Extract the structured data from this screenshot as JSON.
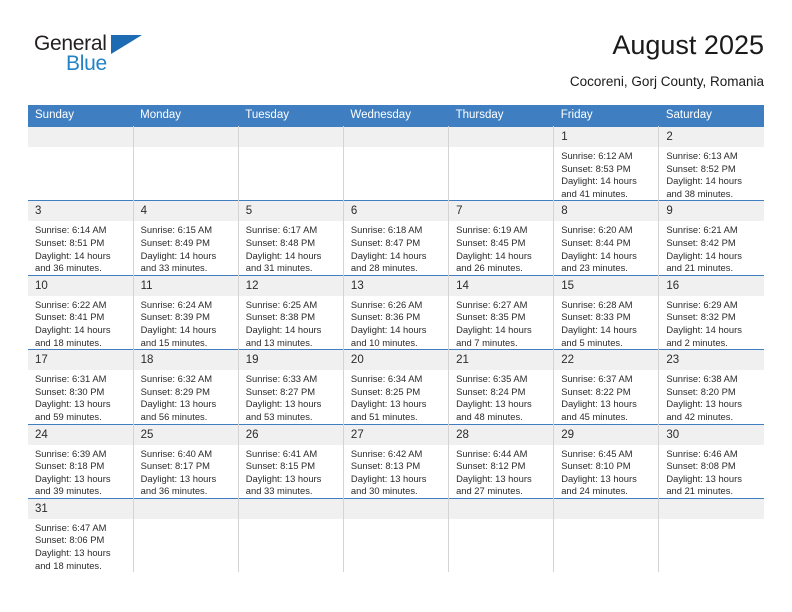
{
  "brand": {
    "name_top": "General",
    "name_bottom": "Blue",
    "flag_icon": "triangle-flag-icon",
    "accent_color": "#2383c6",
    "flag_color": "#1d6cb3"
  },
  "header": {
    "title": "August 2025",
    "subtitle": "Cocoreni, Gorj County, Romania"
  },
  "calendar": {
    "header_bg": "#3f7fc1",
    "daynum_bg": "#f0f0f0",
    "weekday_headers": [
      "Sunday",
      "Monday",
      "Tuesday",
      "Wednesday",
      "Thursday",
      "Friday",
      "Saturday"
    ],
    "weeks": [
      [
        {
          "day": "",
          "empty": true,
          "sunrise": "",
          "sunset": "",
          "daylight_line1": "",
          "daylight_line2": ""
        },
        {
          "day": "",
          "empty": true,
          "sunrise": "",
          "sunset": "",
          "daylight_line1": "",
          "daylight_line2": ""
        },
        {
          "day": "",
          "empty": true,
          "sunrise": "",
          "sunset": "",
          "daylight_line1": "",
          "daylight_line2": ""
        },
        {
          "day": "",
          "empty": true,
          "sunrise": "",
          "sunset": "",
          "daylight_line1": "",
          "daylight_line2": ""
        },
        {
          "day": "",
          "empty": true,
          "sunrise": "",
          "sunset": "",
          "daylight_line1": "",
          "daylight_line2": ""
        },
        {
          "day": "1",
          "empty": false,
          "sunrise": "Sunrise: 6:12 AM",
          "sunset": "Sunset: 8:53 PM",
          "daylight_line1": "Daylight: 14 hours",
          "daylight_line2": "and 41 minutes."
        },
        {
          "day": "2",
          "empty": false,
          "sunrise": "Sunrise: 6:13 AM",
          "sunset": "Sunset: 8:52 PM",
          "daylight_line1": "Daylight: 14 hours",
          "daylight_line2": "and 38 minutes."
        }
      ],
      [
        {
          "day": "3",
          "empty": false,
          "sunrise": "Sunrise: 6:14 AM",
          "sunset": "Sunset: 8:51 PM",
          "daylight_line1": "Daylight: 14 hours",
          "daylight_line2": "and 36 minutes."
        },
        {
          "day": "4",
          "empty": false,
          "sunrise": "Sunrise: 6:15 AM",
          "sunset": "Sunset: 8:49 PM",
          "daylight_line1": "Daylight: 14 hours",
          "daylight_line2": "and 33 minutes."
        },
        {
          "day": "5",
          "empty": false,
          "sunrise": "Sunrise: 6:17 AM",
          "sunset": "Sunset: 8:48 PM",
          "daylight_line1": "Daylight: 14 hours",
          "daylight_line2": "and 31 minutes."
        },
        {
          "day": "6",
          "empty": false,
          "sunrise": "Sunrise: 6:18 AM",
          "sunset": "Sunset: 8:47 PM",
          "daylight_line1": "Daylight: 14 hours",
          "daylight_line2": "and 28 minutes."
        },
        {
          "day": "7",
          "empty": false,
          "sunrise": "Sunrise: 6:19 AM",
          "sunset": "Sunset: 8:45 PM",
          "daylight_line1": "Daylight: 14 hours",
          "daylight_line2": "and 26 minutes."
        },
        {
          "day": "8",
          "empty": false,
          "sunrise": "Sunrise: 6:20 AM",
          "sunset": "Sunset: 8:44 PM",
          "daylight_line1": "Daylight: 14 hours",
          "daylight_line2": "and 23 minutes."
        },
        {
          "day": "9",
          "empty": false,
          "sunrise": "Sunrise: 6:21 AM",
          "sunset": "Sunset: 8:42 PM",
          "daylight_line1": "Daylight: 14 hours",
          "daylight_line2": "and 21 minutes."
        }
      ],
      [
        {
          "day": "10",
          "empty": false,
          "sunrise": "Sunrise: 6:22 AM",
          "sunset": "Sunset: 8:41 PM",
          "daylight_line1": "Daylight: 14 hours",
          "daylight_line2": "and 18 minutes."
        },
        {
          "day": "11",
          "empty": false,
          "sunrise": "Sunrise: 6:24 AM",
          "sunset": "Sunset: 8:39 PM",
          "daylight_line1": "Daylight: 14 hours",
          "daylight_line2": "and 15 minutes."
        },
        {
          "day": "12",
          "empty": false,
          "sunrise": "Sunrise: 6:25 AM",
          "sunset": "Sunset: 8:38 PM",
          "daylight_line1": "Daylight: 14 hours",
          "daylight_line2": "and 13 minutes."
        },
        {
          "day": "13",
          "empty": false,
          "sunrise": "Sunrise: 6:26 AM",
          "sunset": "Sunset: 8:36 PM",
          "daylight_line1": "Daylight: 14 hours",
          "daylight_line2": "and 10 minutes."
        },
        {
          "day": "14",
          "empty": false,
          "sunrise": "Sunrise: 6:27 AM",
          "sunset": "Sunset: 8:35 PM",
          "daylight_line1": "Daylight: 14 hours",
          "daylight_line2": "and 7 minutes."
        },
        {
          "day": "15",
          "empty": false,
          "sunrise": "Sunrise: 6:28 AM",
          "sunset": "Sunset: 8:33 PM",
          "daylight_line1": "Daylight: 14 hours",
          "daylight_line2": "and 5 minutes."
        },
        {
          "day": "16",
          "empty": false,
          "sunrise": "Sunrise: 6:29 AM",
          "sunset": "Sunset: 8:32 PM",
          "daylight_line1": "Daylight: 14 hours",
          "daylight_line2": "and 2 minutes."
        }
      ],
      [
        {
          "day": "17",
          "empty": false,
          "sunrise": "Sunrise: 6:31 AM",
          "sunset": "Sunset: 8:30 PM",
          "daylight_line1": "Daylight: 13 hours",
          "daylight_line2": "and 59 minutes."
        },
        {
          "day": "18",
          "empty": false,
          "sunrise": "Sunrise: 6:32 AM",
          "sunset": "Sunset: 8:29 PM",
          "daylight_line1": "Daylight: 13 hours",
          "daylight_line2": "and 56 minutes."
        },
        {
          "day": "19",
          "empty": false,
          "sunrise": "Sunrise: 6:33 AM",
          "sunset": "Sunset: 8:27 PM",
          "daylight_line1": "Daylight: 13 hours",
          "daylight_line2": "and 53 minutes."
        },
        {
          "day": "20",
          "empty": false,
          "sunrise": "Sunrise: 6:34 AM",
          "sunset": "Sunset: 8:25 PM",
          "daylight_line1": "Daylight: 13 hours",
          "daylight_line2": "and 51 minutes."
        },
        {
          "day": "21",
          "empty": false,
          "sunrise": "Sunrise: 6:35 AM",
          "sunset": "Sunset: 8:24 PM",
          "daylight_line1": "Daylight: 13 hours",
          "daylight_line2": "and 48 minutes."
        },
        {
          "day": "22",
          "empty": false,
          "sunrise": "Sunrise: 6:37 AM",
          "sunset": "Sunset: 8:22 PM",
          "daylight_line1": "Daylight: 13 hours",
          "daylight_line2": "and 45 minutes."
        },
        {
          "day": "23",
          "empty": false,
          "sunrise": "Sunrise: 6:38 AM",
          "sunset": "Sunset: 8:20 PM",
          "daylight_line1": "Daylight: 13 hours",
          "daylight_line2": "and 42 minutes."
        }
      ],
      [
        {
          "day": "24",
          "empty": false,
          "sunrise": "Sunrise: 6:39 AM",
          "sunset": "Sunset: 8:18 PM",
          "daylight_line1": "Daylight: 13 hours",
          "daylight_line2": "and 39 minutes."
        },
        {
          "day": "25",
          "empty": false,
          "sunrise": "Sunrise: 6:40 AM",
          "sunset": "Sunset: 8:17 PM",
          "daylight_line1": "Daylight: 13 hours",
          "daylight_line2": "and 36 minutes."
        },
        {
          "day": "26",
          "empty": false,
          "sunrise": "Sunrise: 6:41 AM",
          "sunset": "Sunset: 8:15 PM",
          "daylight_line1": "Daylight: 13 hours",
          "daylight_line2": "and 33 minutes."
        },
        {
          "day": "27",
          "empty": false,
          "sunrise": "Sunrise: 6:42 AM",
          "sunset": "Sunset: 8:13 PM",
          "daylight_line1": "Daylight: 13 hours",
          "daylight_line2": "and 30 minutes."
        },
        {
          "day": "28",
          "empty": false,
          "sunrise": "Sunrise: 6:44 AM",
          "sunset": "Sunset: 8:12 PM",
          "daylight_line1": "Daylight: 13 hours",
          "daylight_line2": "and 27 minutes."
        },
        {
          "day": "29",
          "empty": false,
          "sunrise": "Sunrise: 6:45 AM",
          "sunset": "Sunset: 8:10 PM",
          "daylight_line1": "Daylight: 13 hours",
          "daylight_line2": "and 24 minutes."
        },
        {
          "day": "30",
          "empty": false,
          "sunrise": "Sunrise: 6:46 AM",
          "sunset": "Sunset: 8:08 PM",
          "daylight_line1": "Daylight: 13 hours",
          "daylight_line2": "and 21 minutes."
        }
      ],
      [
        {
          "day": "31",
          "empty": false,
          "sunrise": "Sunrise: 6:47 AM",
          "sunset": "Sunset: 8:06 PM",
          "daylight_line1": "Daylight: 13 hours",
          "daylight_line2": "and 18 minutes."
        },
        {
          "day": "",
          "empty": true,
          "sunrise": "",
          "sunset": "",
          "daylight_line1": "",
          "daylight_line2": ""
        },
        {
          "day": "",
          "empty": true,
          "sunrise": "",
          "sunset": "",
          "daylight_line1": "",
          "daylight_line2": ""
        },
        {
          "day": "",
          "empty": true,
          "sunrise": "",
          "sunset": "",
          "daylight_line1": "",
          "daylight_line2": ""
        },
        {
          "day": "",
          "empty": true,
          "sunrise": "",
          "sunset": "",
          "daylight_line1": "",
          "daylight_line2": ""
        },
        {
          "day": "",
          "empty": true,
          "sunrise": "",
          "sunset": "",
          "daylight_line1": "",
          "daylight_line2": ""
        },
        {
          "day": "",
          "empty": true,
          "sunrise": "",
          "sunset": "",
          "daylight_line1": "",
          "daylight_line2": ""
        }
      ]
    ]
  }
}
